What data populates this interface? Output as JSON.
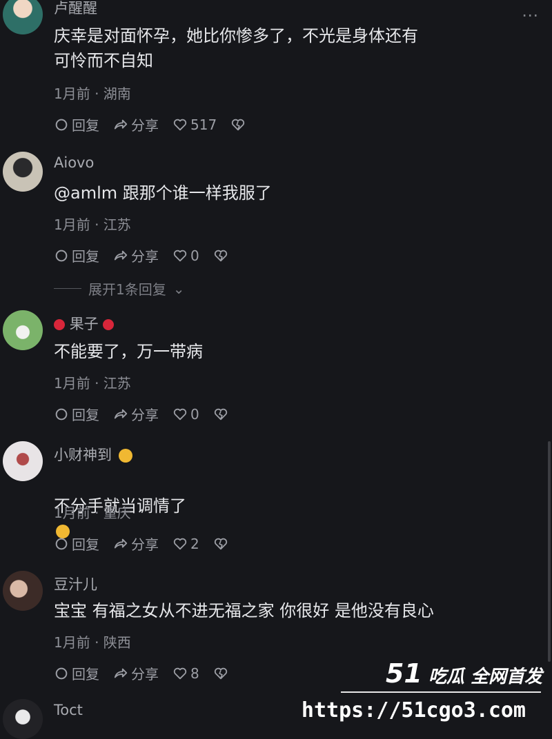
{
  "comments": [
    {
      "username": "卢醒醒",
      "text": "庆幸是对面怀孕，她比你惨多了，不光是身体还有\n可怜而不自知",
      "meta": "1月前 · 湖南",
      "reply_label": "回复",
      "share_label": "分享",
      "likes": "517"
    },
    {
      "username": "Aiovo",
      "text": "@amlm 跟那个谁一样我服了",
      "meta": "1月前 · 江苏",
      "reply_label": "回复",
      "share_label": "分享",
      "likes": "0",
      "expand_label": "展开1条回复"
    },
    {
      "username": "果子",
      "text": "不能要了，万一带病",
      "meta": "1月前 · 江苏",
      "reply_label": "回复",
      "share_label": "分享",
      "likes": "0"
    },
    {
      "username": "小财神到",
      "text": "不分手就当调情了",
      "meta": "1月前 · 重庆",
      "reply_label": "回复",
      "share_label": "分享",
      "likes": "2"
    },
    {
      "username": "豆汁儿",
      "text": "宝宝 有福之女从不进无福之家 你很好 是他没有良心",
      "meta": "1月前 · 陕西",
      "reply_label": "回复",
      "share_label": "分享",
      "likes": "8"
    },
    {
      "username": "Toct",
      "text": "",
      "meta": "",
      "reply_label": "",
      "share_label": "",
      "likes": ""
    }
  ],
  "watermark": {
    "title_num": "51",
    "title": "吃瓜 全网首发",
    "url": "https://51cgo3.com"
  },
  "icons": {
    "reply": "comment-bubble-icon",
    "share": "share-arrow-icon",
    "like": "heart-icon",
    "dislike": "broken-heart-icon",
    "more": "more-dots-icon"
  },
  "colors": {
    "background": "#16171b",
    "text": "#e6e7ea",
    "meta": "#8d8f96"
  }
}
